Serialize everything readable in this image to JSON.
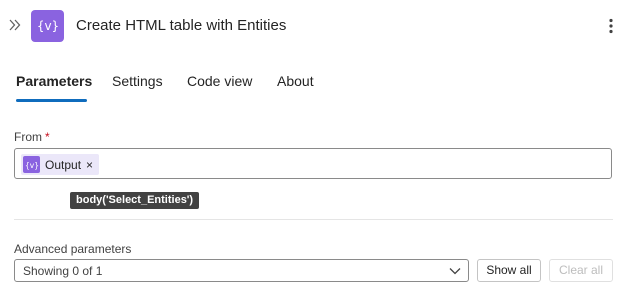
{
  "header": {
    "title": "Create HTML table with Entities",
    "icon": "variable-braces-icon",
    "icon_color": "#8a63e0"
  },
  "tabs": [
    {
      "label": "Parameters",
      "active": true
    },
    {
      "label": "Settings",
      "active": false
    },
    {
      "label": "Code view",
      "active": false
    },
    {
      "label": "About",
      "active": false
    }
  ],
  "accent_color": "#0f6cbd",
  "from_field": {
    "label": "From",
    "required_marker": "*",
    "required_color": "#c50f1f",
    "token": {
      "label": "Output",
      "remove_symbol": "×",
      "icon": "variable-braces-icon",
      "icon_color": "#8a63e0"
    },
    "tooltip": "body('Select_Entities')"
  },
  "advanced": {
    "label": "Advanced parameters",
    "selected": "Showing 0 of 1",
    "show_all_label": "Show all",
    "clear_all_label": "Clear all",
    "clear_all_disabled": true
  }
}
